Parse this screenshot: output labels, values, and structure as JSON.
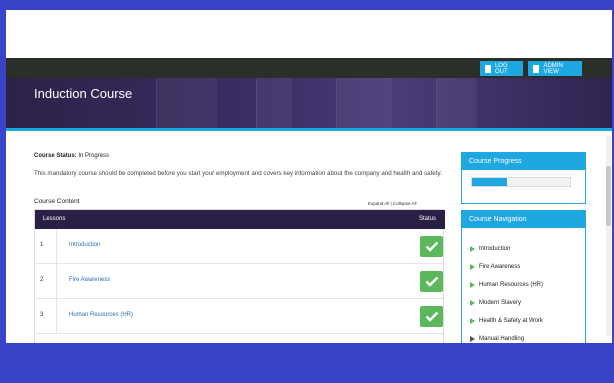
{
  "header": {
    "logout_label": "LOG OUT",
    "adminview_label": "ADMIN VIEW",
    "title": "Induction Course"
  },
  "course": {
    "status_label": "Course Status:",
    "status_value": "In Progress",
    "description": "This mandatory course should be completed before you start your employment and covers key information about the company and health and safety.",
    "content_label": "Course Content",
    "expand_collapse": "Expand All | Collapse All"
  },
  "lessons_table": {
    "col_lessons": "Lessons",
    "col_status": "Status",
    "rows": [
      {
        "num": "1",
        "name": "Introduction"
      },
      {
        "num": "2",
        "name": "Fire Awareness"
      },
      {
        "num": "3",
        "name": "Human Resources (HR)"
      }
    ]
  },
  "progress": {
    "title": "Course Progress",
    "fraction": 0.36
  },
  "navigation": {
    "title": "Course Navigation",
    "items": [
      "Introduction",
      "Fire Awareness",
      "Human Resources (HR)",
      "Modern Slavery",
      "Health & Safety at Work",
      "Manual Handling"
    ]
  },
  "colors": {
    "accent": "#1ea7e0",
    "header_dark": "#2a2045",
    "complete_green": "#5cb85c",
    "link": "#2e6fb5"
  }
}
